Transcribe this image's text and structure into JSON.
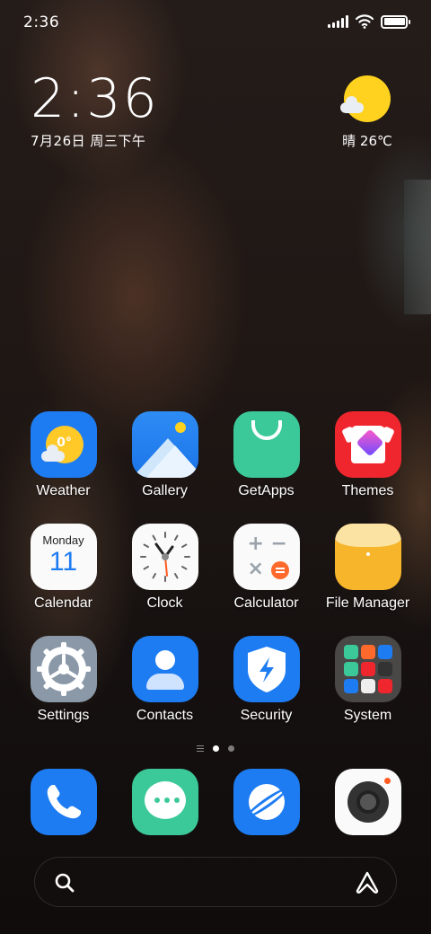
{
  "status_bar": {
    "time": "2:36",
    "icons": [
      "signal-icon",
      "wifi-icon",
      "battery-icon"
    ]
  },
  "clock_widget": {
    "time": "2:36",
    "date": "7月26日 周三下午"
  },
  "weather_widget": {
    "icon": "sunny-cloud-icon",
    "text": "晴 26℃"
  },
  "apps": {
    "weather": {
      "label": "Weather",
      "icon_text": "0°"
    },
    "gallery": {
      "label": "Gallery"
    },
    "getapps": {
      "label": "GetApps"
    },
    "themes": {
      "label": "Themes"
    },
    "calendar": {
      "label": "Calendar",
      "weekday": "Monday",
      "day": "11"
    },
    "clock": {
      "label": "Clock"
    },
    "calculator": {
      "label": "Calculator"
    },
    "file_manager": {
      "label": "File Manager"
    },
    "settings": {
      "label": "Settings"
    },
    "contacts": {
      "label": "Contacts"
    },
    "security": {
      "label": "Security"
    },
    "system": {
      "label": "System"
    }
  },
  "page_indicator": {
    "pages": 2,
    "current": 1
  },
  "dock": [
    "phone",
    "messages",
    "browser",
    "camera"
  ],
  "colors": {
    "blue": "#1e7cf2",
    "green": "#3cc99a",
    "red": "#f0262e",
    "yellow": "#f7b52c",
    "sun": "#ffd21f",
    "orange": "#ff5a1f"
  }
}
